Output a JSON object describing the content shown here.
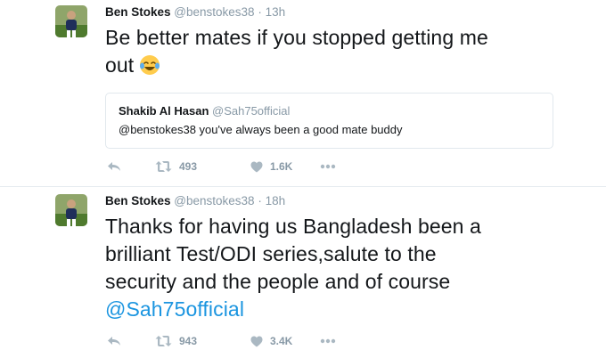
{
  "tweets": [
    {
      "author": {
        "name": "Ben Stokes",
        "handle": "@benstokes38",
        "time": "13h"
      },
      "text_line1": "Be better mates if you stopped getting me",
      "text_line2": "out",
      "emoji": "face-with-tears-of-joy",
      "quote": {
        "name": "Shakib Al Hasan",
        "handle": "@Sah75official",
        "text": "@benstokes38 you've always been a good mate buddy"
      },
      "retweets": "493",
      "likes": "1.6K"
    },
    {
      "author": {
        "name": "Ben Stokes",
        "handle": "@benstokes38",
        "time": "18h"
      },
      "text_line1": "Thanks for having us Bangladesh been a",
      "text_line2": "brilliant Test/ODI series,salute to the",
      "text_line3": "security and the people and of course",
      "mention": "@Sah75official",
      "retweets": "943",
      "likes": "3.4K"
    }
  ],
  "separator": "·",
  "colors": {
    "text": "#14171a",
    "secondary": "#8899a6",
    "icon": "#aab8c2",
    "link": "#1b95e0",
    "border": "#e1e8ed"
  },
  "icons": [
    "reply-icon",
    "retweet-icon",
    "like-icon",
    "more-icon"
  ]
}
